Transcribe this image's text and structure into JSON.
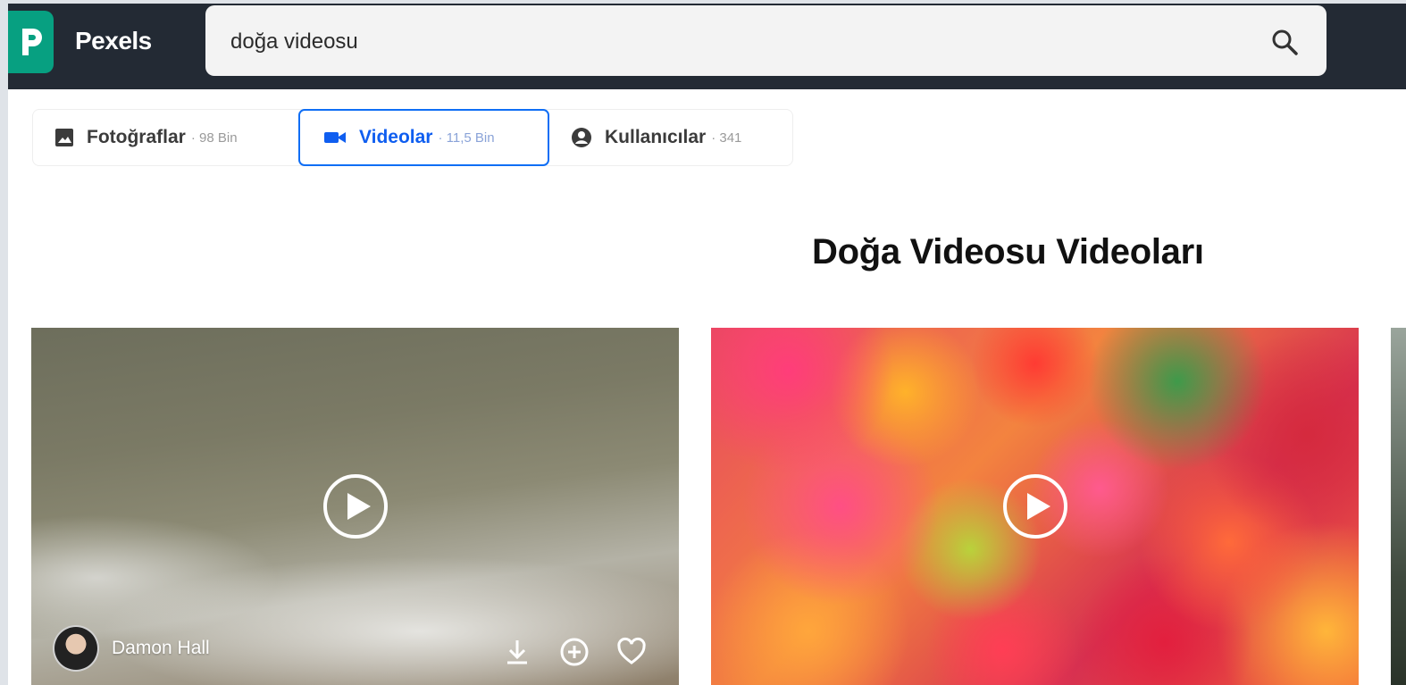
{
  "header": {
    "brand": "Pexels",
    "search_value": "doğa videosu"
  },
  "tabs": [
    {
      "label": "Fotoğraflar",
      "count": "· 98 Bin",
      "icon": "image-icon"
    },
    {
      "label": "Videolar",
      "count": "· 11,5 Bin",
      "icon": "video-camera-icon",
      "active": true
    },
    {
      "label": "Kullanıcılar",
      "count": "· 341",
      "icon": "user-circle-icon"
    }
  ],
  "page_title": "Doğa Videosu Videoları",
  "cards": [
    {
      "author": "Damon Hall",
      "icons": [
        "play-icon",
        "download-icon",
        "add-collection-icon",
        "heart-icon"
      ]
    },
    {
      "icons": [
        "play-icon"
      ]
    }
  ],
  "colors": {
    "header_bg": "#232a34",
    "brand_green": "#07a081",
    "active_tab": "#0f6ef5"
  }
}
